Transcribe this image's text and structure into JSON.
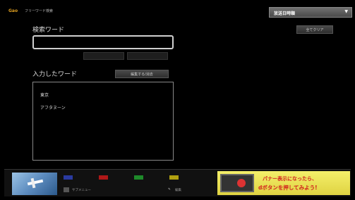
{
  "header": {
    "logo": "Gao",
    "title": "フリーワード検索",
    "sort_select": "放送日時順",
    "all_clear_label": "全てクリア"
  },
  "search": {
    "label": "検索ワード",
    "value": "",
    "sub_buttons": [
      "",
      ""
    ]
  },
  "entered": {
    "label": "入力したワード",
    "edit_button": "編集する/消去",
    "words": [
      "東京",
      "アフタヌーン"
    ]
  },
  "footer": {
    "color_keys": [
      {
        "color": "#2a3aa0",
        "label": ""
      },
      {
        "color": "#b01818",
        "label": ""
      },
      {
        "color": "#1e8a2a",
        "label": ""
      },
      {
        "color": "#b0a010",
        "label": ""
      }
    ],
    "menu_label": "サブメニュー",
    "extra_label": "",
    "edit_label": "編集",
    "banner_line1": "パナー表示になったら、",
    "banner_line2": "dボタンを押してみよう!"
  },
  "colors": {
    "background": "#000000",
    "banner_bg": "#f0e860",
    "banner_text": "#d21c1c",
    "logo": "#e0a020"
  }
}
